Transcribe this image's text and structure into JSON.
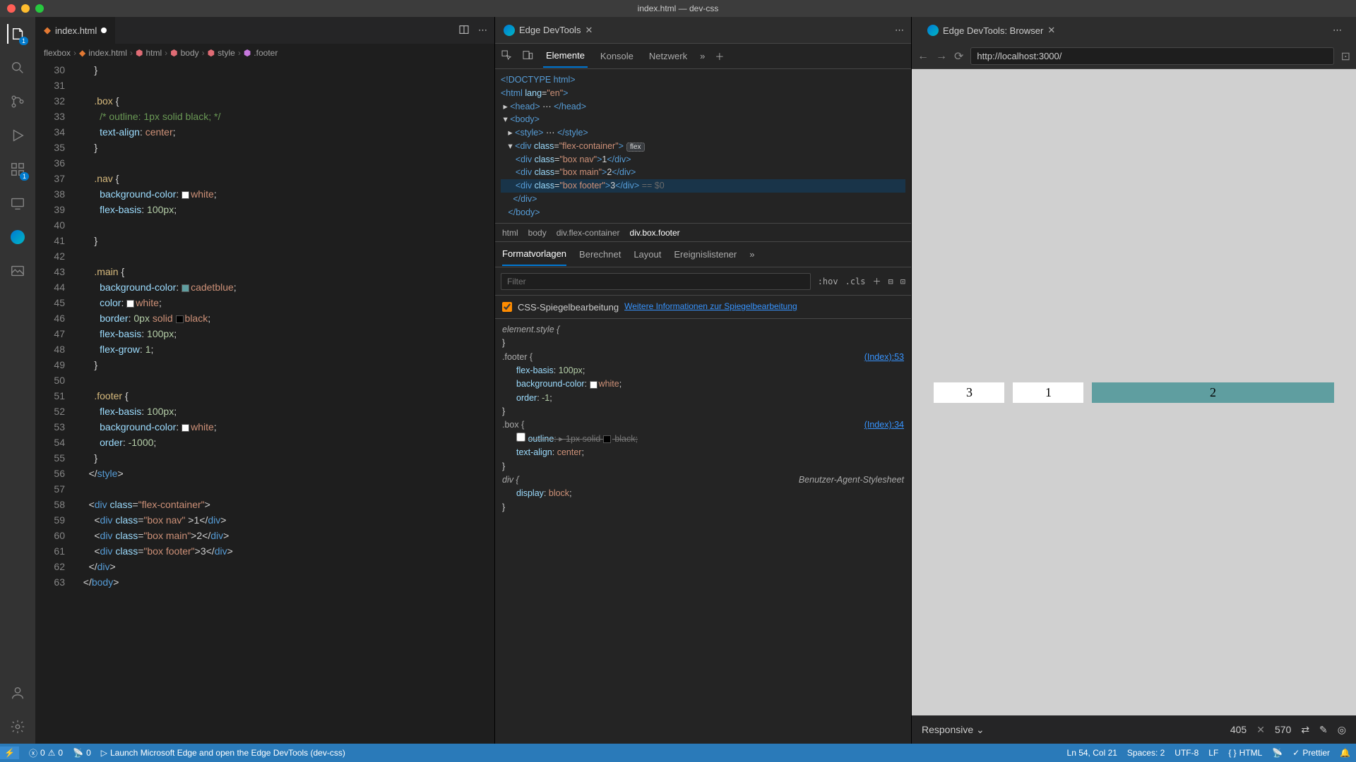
{
  "window": {
    "title": "index.html — dev-css"
  },
  "editor": {
    "tab": {
      "filename": "index.html"
    },
    "breadcrumb": [
      "flexbox",
      "index.html",
      "html",
      "body",
      "style",
      ".footer"
    ],
    "lines": [
      {
        "n": 30,
        "html": "      <span class='tok-punc'>}</span>"
      },
      {
        "n": 31,
        "html": ""
      },
      {
        "n": 32,
        "html": "      <span class='tok-sel'>.box</span> <span class='tok-punc'>{</span>"
      },
      {
        "n": 33,
        "html": "        <span class='tok-comment'>/* outline: 1px solid black; */</span>"
      },
      {
        "n": 34,
        "html": "        <span class='tok-prop'>text-align</span><span class='tok-punc'>:</span> <span class='tok-val'>center</span><span class='tok-punc'>;</span>"
      },
      {
        "n": 35,
        "html": "      <span class='tok-punc'>}</span>"
      },
      {
        "n": 36,
        "html": ""
      },
      {
        "n": 37,
        "html": "      <span class='tok-sel'>.nav</span> <span class='tok-punc'>{</span>"
      },
      {
        "n": 38,
        "html": "        <span class='tok-prop'>background-color</span><span class='tok-punc'>:</span> <span class='swatch' style='background:#fff'></span><span class='tok-val'>white</span><span class='tok-punc'>;</span>"
      },
      {
        "n": 39,
        "html": "        <span class='tok-prop'>flex-basis</span><span class='tok-punc'>:</span> <span class='tok-num'>100px</span><span class='tok-punc'>;</span>"
      },
      {
        "n": 40,
        "html": ""
      },
      {
        "n": 41,
        "html": "      <span class='tok-punc'>}</span>"
      },
      {
        "n": 42,
        "html": ""
      },
      {
        "n": 43,
        "html": "      <span class='tok-sel'>.main</span> <span class='tok-punc'>{</span>"
      },
      {
        "n": 44,
        "html": "        <span class='tok-prop'>background-color</span><span class='tok-punc'>:</span> <span class='swatch' style='background:#5f9ea0'></span><span class='tok-val'>cadetblue</span><span class='tok-punc'>;</span>"
      },
      {
        "n": 45,
        "html": "        <span class='tok-prop'>color</span><span class='tok-punc'>:</span> <span class='swatch' style='background:#fff'></span><span class='tok-val'>white</span><span class='tok-punc'>;</span>"
      },
      {
        "n": 46,
        "html": "        <span class='tok-prop'>border</span><span class='tok-punc'>:</span> <span class='tok-num'>0px</span> <span class='tok-val'>solid</span> <span class='swatch' style='background:#000'></span><span class='tok-val'>black</span><span class='tok-punc'>;</span>"
      },
      {
        "n": 47,
        "html": "        <span class='tok-prop'>flex-basis</span><span class='tok-punc'>:</span> <span class='tok-num'>100px</span><span class='tok-punc'>;</span>"
      },
      {
        "n": 48,
        "html": "        <span class='tok-prop'>flex-grow</span><span class='tok-punc'>:</span> <span class='tok-num'>1</span><span class='tok-punc'>;</span>"
      },
      {
        "n": 49,
        "html": "      <span class='tok-punc'>}</span>"
      },
      {
        "n": 50,
        "html": ""
      },
      {
        "n": 51,
        "html": "      <span class='tok-sel'>.footer</span> <span class='tok-punc'>{</span>"
      },
      {
        "n": 52,
        "html": "        <span class='tok-prop'>flex-basis</span><span class='tok-punc'>:</span> <span class='tok-num'>100px</span><span class='tok-punc'>;</span>"
      },
      {
        "n": 53,
        "html": "        <span class='tok-prop'>background-color</span><span class='tok-punc'>:</span> <span class='swatch' style='background:#fff'></span><span class='tok-val'>white</span><span class='tok-punc'>;</span>"
      },
      {
        "n": 54,
        "html": "        <span class='tok-prop'>order</span><span class='tok-punc'>:</span> <span class='tok-num'>-1000</span><span class='tok-punc'>;</span>"
      },
      {
        "n": 55,
        "html": "      <span class='tok-punc'>}</span>"
      },
      {
        "n": 56,
        "html": "    <span class='tok-punc'>&lt;/</span><span class='tok-tag'>style</span><span class='tok-punc'>&gt;</span>"
      },
      {
        "n": 57,
        "html": ""
      },
      {
        "n": 58,
        "html": "    <span class='tok-punc'>&lt;</span><span class='tok-tag'>div</span> <span class='tok-attr'>class</span>=<span class='tok-str'>\"flex-container\"</span><span class='tok-punc'>&gt;</span>"
      },
      {
        "n": 59,
        "html": "      <span class='tok-punc'>&lt;</span><span class='tok-tag'>div</span> <span class='tok-attr'>class</span>=<span class='tok-str'>\"box nav\"</span> <span class='tok-punc'>&gt;</span>1<span class='tok-punc'>&lt;/</span><span class='tok-tag'>div</span><span class='tok-punc'>&gt;</span>"
      },
      {
        "n": 60,
        "html": "      <span class='tok-punc'>&lt;</span><span class='tok-tag'>div</span> <span class='tok-attr'>class</span>=<span class='tok-str'>\"box main\"</span><span class='tok-punc'>&gt;</span>2<span class='tok-punc'>&lt;/</span><span class='tok-tag'>div</span><span class='tok-punc'>&gt;</span>"
      },
      {
        "n": 61,
        "html": "      <span class='tok-punc'>&lt;</span><span class='tok-tag'>div</span> <span class='tok-attr'>class</span>=<span class='tok-str'>\"box footer\"</span><span class='tok-punc'>&gt;</span>3<span class='tok-punc'>&lt;/</span><span class='tok-tag'>div</span><span class='tok-punc'>&gt;</span>"
      },
      {
        "n": 62,
        "html": "    <span class='tok-punc'>&lt;/</span><span class='tok-tag'>div</span><span class='tok-punc'>&gt;</span>"
      },
      {
        "n": 63,
        "html": "  <span class='tok-punc'>&lt;/</span><span class='tok-tag'>body</span><span class='tok-punc'>&gt;</span>"
      }
    ]
  },
  "devtools": {
    "title": "Edge DevTools",
    "tabs": {
      "elements": "Elemente",
      "console": "Konsole",
      "network": "Netzwerk"
    },
    "dom": [
      "<span class='dom-tag'>&lt;!DOCTYPE html&gt;</span>",
      "<span class='dom-tag'>&lt;html</span> <span class='dom-attr'>lang</span>=<span class='dom-val'>\"en\"</span><span class='dom-tag'>&gt;</span>",
      " ▸ <span class='dom-tag'>&lt;head&gt;</span> <span class='dom-text'>⋯</span> <span class='dom-tag'>&lt;/head&gt;</span>",
      " ▾ <span class='dom-tag'>&lt;body&gt;</span>",
      "   ▸ <span class='dom-tag'>&lt;style&gt;</span> <span class='dom-text'>⋯</span> <span class='dom-tag'>&lt;/style&gt;</span>",
      "   ▾ <span class='dom-tag'>&lt;div</span> <span class='dom-attr'>class</span>=<span class='dom-val'>\"flex-container\"</span><span class='dom-tag'>&gt;</span><span class='dom-flex-badge'>flex</span>",
      "      <span class='dom-tag'>&lt;div</span> <span class='dom-attr'>class</span>=<span class='dom-val'>\"box nav\"</span><span class='dom-tag'>&gt;</span><span class='dom-text'>1</span><span class='dom-tag'>&lt;/div&gt;</span>",
      "      <span class='dom-tag'>&lt;div</span> <span class='dom-attr'>class</span>=<span class='dom-val'>\"box main\"</span><span class='dom-tag'>&gt;</span><span class='dom-text'>2</span><span class='dom-tag'>&lt;/div&gt;</span>",
      "      <span class='dom-tag'>&lt;div</span> <span class='dom-attr'>class</span>=<span class='dom-val'>\"box footer\"</span><span class='dom-tag'>&gt;</span><span class='dom-text'>3</span><span class='dom-tag'>&lt;/div&gt;</span> <span class='dom-eq'>== $0</span>",
      "     <span class='dom-tag'>&lt;/div&gt;</span>",
      "   <span class='dom-tag'>&lt;/body&gt;</span>"
    ],
    "crumbs": [
      "html",
      "body",
      "div.flex-container",
      "div.box.footer"
    ],
    "styles_tabs": {
      "styles": "Formatvorlagen",
      "computed": "Berechnet",
      "layout": "Layout",
      "listeners": "Ereignislistener"
    },
    "filter_placeholder": "Filter",
    "hov": ":hov",
    "cls": ".cls",
    "mirror": {
      "label": "CSS-Spiegelbearbeitung",
      "link": "Weitere Informationen zur Spiegelbearbeitung"
    },
    "rules": {
      "element_style": "element.style {",
      "footer_sel": ".footer {",
      "footer_src": "(Index):53",
      "footer_props": [
        "<span class='tok-prop'>flex-basis</span>: <span class='tok-num'>100px</span>;",
        "<span class='tok-prop'>background-color</span>: <span class='swatch' style='background:#fff'></span><span class='tok-val'>white</span>;",
        "<span class='tok-prop'>order</span>: <span class='tok-num'>-1</span>;"
      ],
      "box_sel": ".box {",
      "box_src": "(Index):34",
      "box_props": [
        "<input type='checkbox' style='accent-color:#888'> <span class='strike'><span class='tok-prop'>outline</span>: ▸ 1px solid <span class='swatch' style='background:#000'></span> black;</span>",
        "<span class='tok-prop'>text-align</span>: <span class='tok-val'>center</span>;"
      ],
      "div_sel": "div {",
      "div_src": "Benutzer-Agent-Stylesheet",
      "div_props": [
        "<span class='tok-prop'>display</span>: <span class='tok-val'>block</span>;"
      ]
    }
  },
  "browser": {
    "title": "Edge DevTools: Browser",
    "url": "http://localhost:3000/",
    "boxes": [
      "3",
      "1",
      "2"
    ],
    "device": "Responsive",
    "width": "405",
    "height": "570"
  },
  "status": {
    "errors": "0",
    "warnings": "0",
    "ports": "0",
    "launch": "Launch Microsoft Edge and open the Edge DevTools (dev-css)",
    "cursor": "Ln 54, Col 21",
    "spaces": "Spaces: 2",
    "encoding": "UTF-8",
    "eol": "LF",
    "lang": "HTML",
    "prettier": "Prettier"
  },
  "activity_badges": {
    "explorer": "1",
    "extensions": "1"
  }
}
